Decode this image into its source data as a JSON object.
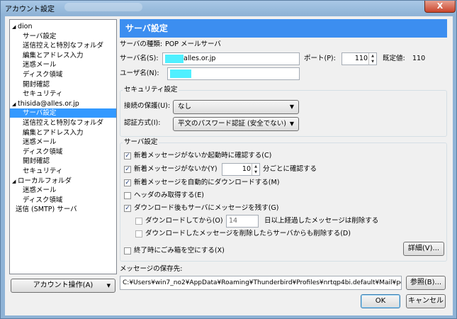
{
  "window": {
    "title": "アカウント設定",
    "close_label": "X"
  },
  "tree": {
    "items": [
      {
        "label": "dion",
        "level": 0,
        "expanded": true
      },
      {
        "label": "サーバ設定",
        "level": 1
      },
      {
        "label": "送信控えと特別なフォルダ",
        "level": 1
      },
      {
        "label": "編集とアドレス入力",
        "level": 1
      },
      {
        "label": "迷惑メール",
        "level": 1
      },
      {
        "label": "ディスク領域",
        "level": 1
      },
      {
        "label": "開封確認",
        "level": 1
      },
      {
        "label": "セキュリティ",
        "level": 1
      },
      {
        "label": "thisida@alles.or.jp",
        "level": 0,
        "expanded": true
      },
      {
        "label": "サーバ設定",
        "level": 1,
        "selected": true
      },
      {
        "label": "送信控えと特別なフォルダ",
        "level": 1
      },
      {
        "label": "編集とアドレス入力",
        "level": 1
      },
      {
        "label": "迷惑メール",
        "level": 1
      },
      {
        "label": "ディスク領域",
        "level": 1
      },
      {
        "label": "開封確認",
        "level": 1
      },
      {
        "label": "セキュリティ",
        "level": 1
      },
      {
        "label": "ローカルフォルダ",
        "level": 0,
        "expanded": true
      },
      {
        "label": "迷惑メール",
        "level": 1
      },
      {
        "label": "ディスク領域",
        "level": 1
      },
      {
        "label": "送信 (SMTP) サーバ",
        "level": 0
      }
    ],
    "account_actions_label": "アカウント操作(A)"
  },
  "panel": {
    "header": "サーバ設定",
    "server_type_label": "サーバの種類:",
    "server_type_value": "POP メールサーバ",
    "server_name_label": "サーバ名(S):",
    "server_name_value": "alles.or.jp",
    "port_label": "ポート(P):",
    "port_value": "110",
    "default_label": "既定値:",
    "default_value": "110",
    "username_label": "ユーザ名(N):",
    "username_value": ""
  },
  "security": {
    "title": "セキュリティ設定",
    "connection_label": "接続の保護(U):",
    "connection_value": "なし",
    "auth_label": "認証方式(I):",
    "auth_value": "平文のパスワード認証 (安全でない)"
  },
  "server_settings": {
    "title": "サーバ設定",
    "check_on_startup": {
      "label": "新着メッセージがないか起動時に確認する(C)",
      "checked": true
    },
    "check_interval": {
      "label_before": "新着メッセージがないか(Y)",
      "value": "10",
      "label_after": "分ごとに確認する",
      "checked": true
    },
    "auto_download": {
      "label": "新着メッセージを自動的にダウンロードする(M)",
      "checked": true
    },
    "headers_only": {
      "label": "ヘッダのみ取得する(E)",
      "checked": false
    },
    "leave_on_server": {
      "label": "ダウンロード後もサーバにメッセージを残す(G)",
      "checked": true
    },
    "delete_after_days": {
      "label_before": "ダウンロードしてから(O)",
      "value": "14",
      "label_after": "日以上経過したメッセージは削除する",
      "checked": false
    },
    "delete_when_deleted": {
      "label": "ダウンロードしたメッセージを削除したらサーバからも削除する(D)",
      "checked": false
    },
    "empty_trash": {
      "label": "終了時にごみ箱を空にする(X)",
      "checked": false
    },
    "advanced_label": "詳細(V)..."
  },
  "storage": {
    "label": "メッセージの保存先:",
    "path": "C:¥Users¥win7_no2¥AppData¥Roaming¥Thunderbird¥Profiles¥nrtqp4bi.default¥Mail¥pop.",
    "browse_label": "参照(B)..."
  },
  "footer": {
    "ok_label": "OK",
    "cancel_label": "キャンセル"
  },
  "colors": {
    "header_bg": "#3c8ef0",
    "selected_bg": "#3399ff",
    "redaction": "#4ff0ff"
  }
}
